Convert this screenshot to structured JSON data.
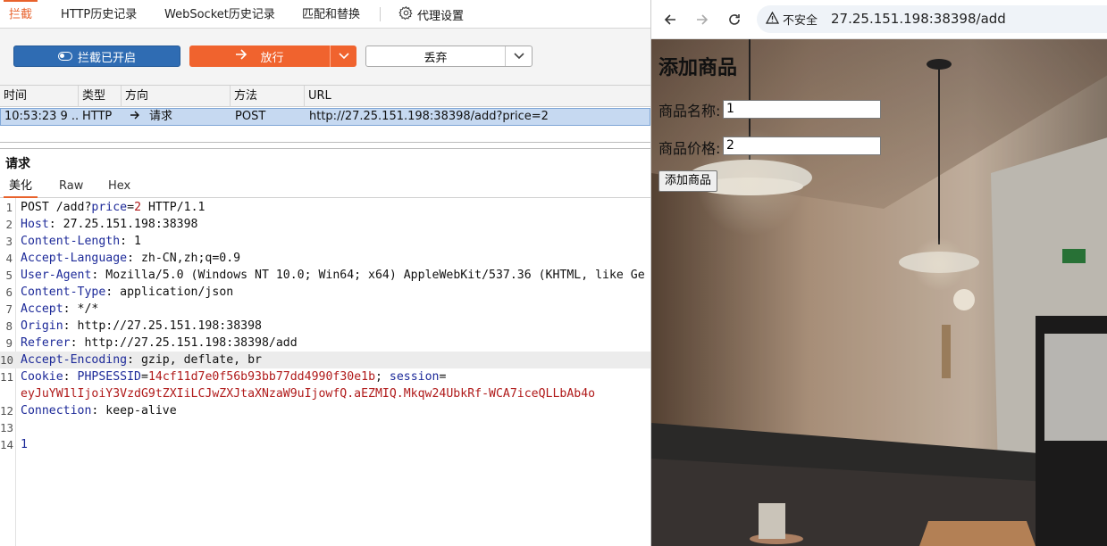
{
  "burp": {
    "tabs": [
      {
        "label": "拦截",
        "active": true
      },
      {
        "label": "HTTP历史记录"
      },
      {
        "label": "WebSocket历史记录"
      },
      {
        "label": "匹配和替换"
      },
      {
        "label": "代理设置",
        "icon": "gear-icon"
      }
    ],
    "toolbar": {
      "intercept_label": "拦截已开启",
      "forward_label": "放行",
      "drop_label": "丢弃"
    },
    "history": {
      "columns": [
        "时间",
        "类型",
        "方向",
        "方法",
        "URL"
      ],
      "rows": [
        {
          "time": "10:53:23 9 ...",
          "type": "HTTP",
          "direction": "请求",
          "method": "POST",
          "url": "http://27.25.151.198:38398/add?price=2"
        }
      ]
    },
    "request": {
      "title": "请求",
      "subtabs": [
        "美化",
        "Raw",
        "Hex"
      ],
      "line_numbers": [
        "1",
        "2",
        "3",
        "4",
        "5",
        "6",
        "7",
        "8",
        "9",
        "10",
        "11",
        "",
        "12",
        "13",
        "14"
      ],
      "lines": {
        "l1_a": "POST /add?",
        "l1_b": "price",
        "l1_c": "=",
        "l1_d": "2",
        "l1_e": " HTTP/1.1",
        "host_k": "Host",
        "host_v": ": 27.25.151.198:38398",
        "cl_k": "Content-Length",
        "cl_v": ": 1",
        "al_k": "Accept-Language",
        "al_v": ": zh-CN,zh;q=0.9",
        "ua_k": "User-Agent",
        "ua_v": ": Mozilla/5.0 (Windows NT 10.0; Win64; x64) AppleWebKit/537.36 (KHTML, like Ge",
        "ct_k": "Content-Type",
        "ct_v": ": application/json",
        "ac_k": "Accept",
        "ac_v": ": */*",
        "or_k": "Origin",
        "or_v": ": http://27.25.151.198:38398",
        "rf_k": "Referer",
        "rf_v": ": http://27.25.151.198:38398/add",
        "ae_k": "Accept-Encoding",
        "ae_v": ": gzip, deflate, br",
        "ck_k": "Cookie",
        "ck_sep": ": ",
        "ck_n1": "PHPSESSID",
        "ck_eq": "=",
        "ck_v1": "14cf11d7e0f56b93bb77dd4990f30e1b",
        "ck_semi": "; ",
        "ck_n2": "session",
        "ck_eq2": "=",
        "ck_v2": "eyJuYW1lIjoiY3VzdG9tZXIiLCJwZXJtaXNzaW9uIjowfQ.aEZMIQ.Mkqw24UbkRf-WCA7iceQLLbAb4o",
        "cn_k": "Connection",
        "cn_v": ": keep-alive",
        "body": "1"
      }
    }
  },
  "browser": {
    "security_label": "不安全",
    "url": "27.25.151.198:38398/add",
    "page": {
      "title": "添加商品",
      "name_label": "商品名称:",
      "name_value": "1",
      "price_label": "商品价格:",
      "price_value": "2",
      "submit_label": "添加商品"
    }
  },
  "colors": {
    "accent": "#e8622c",
    "intercept_blue": "#2f6cb3",
    "forward_orange": "#f0632e",
    "selected_row": "#c6d9f1"
  }
}
